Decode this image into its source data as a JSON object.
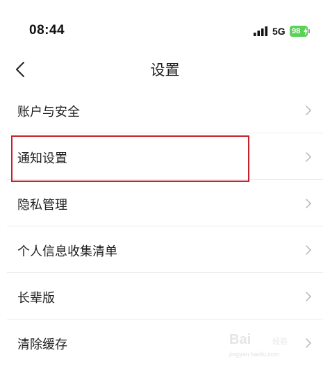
{
  "status_bar": {
    "time": "08:44",
    "network": "5G",
    "battery_level": "98"
  },
  "nav": {
    "title": "设置",
    "back_icon": "chevron-left-icon"
  },
  "settings": {
    "items": [
      {
        "label": "账户与安全"
      },
      {
        "label": "通知设置"
      },
      {
        "label": "隐私管理"
      },
      {
        "label": "个人信息收集清单"
      },
      {
        "label": "长辈版"
      },
      {
        "label": "清除缓存"
      }
    ]
  },
  "annotation": {
    "highlight_color": "#c8202a"
  },
  "watermark": {
    "brand": "Bai",
    "sub": "经验",
    "url": "jingyan.baidu.com"
  },
  "colors": {
    "battery": "#5bd15a",
    "divider": "#ececec",
    "chevron": "#b5b5b5"
  }
}
